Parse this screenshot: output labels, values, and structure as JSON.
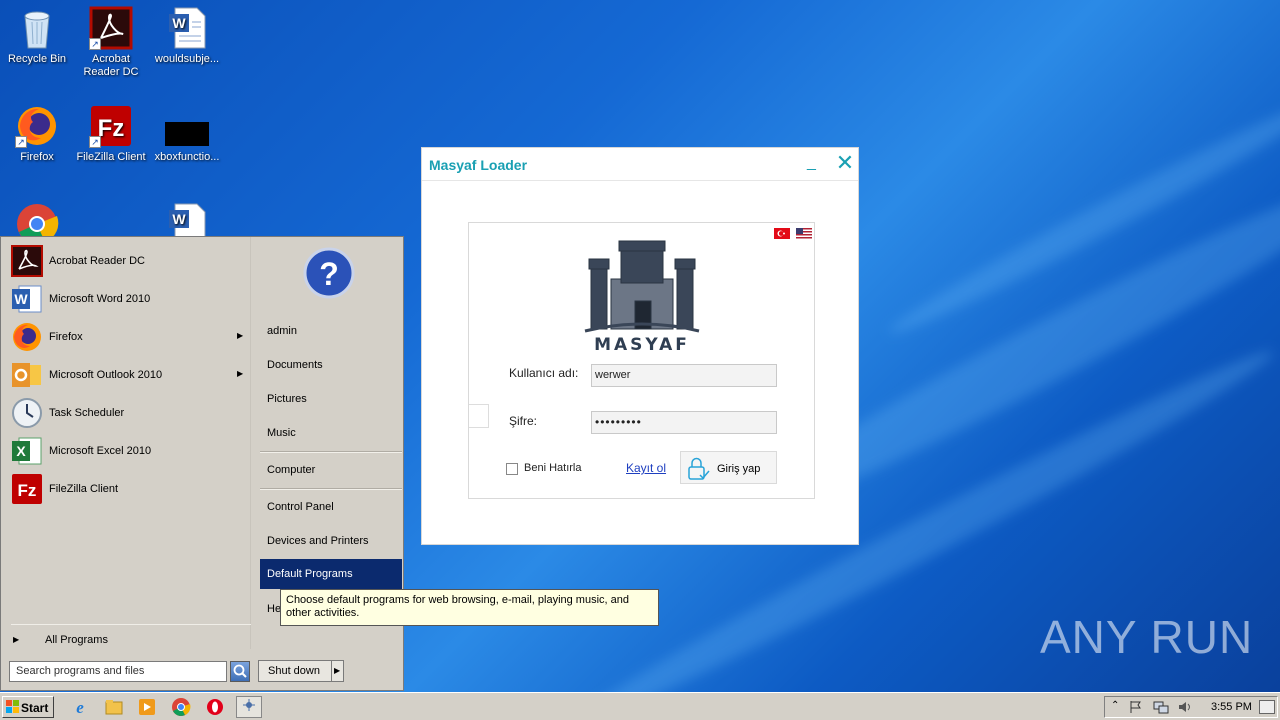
{
  "desktop": {
    "icons": [
      {
        "label": "Recycle Bin",
        "icon": "recycle-bin-icon"
      },
      {
        "label": "Acrobat Reader DC",
        "icon": "acrobat-icon"
      },
      {
        "label": "wouldsubje...",
        "icon": "word-doc-icon"
      },
      {
        "label": "Firefox",
        "icon": "firefox-icon"
      },
      {
        "label": "FileZilla Client",
        "icon": "filezilla-icon"
      },
      {
        "label": "xboxfunctio...",
        "icon": "black-file-icon"
      }
    ]
  },
  "loader": {
    "title": "Masyaf Loader",
    "minimize": "_",
    "close": "✕",
    "brand": "MASYAF",
    "username_label": "Kullanıcı adı:",
    "username_value": "werwer",
    "password_label": "Şifre:",
    "password_value": "•••••••••",
    "remember_label": "Beni Hatırla",
    "register_label": "Kayıt ol",
    "login_label": "Giriş yap",
    "flags": [
      "turkey-flag-icon",
      "us-flag-icon"
    ]
  },
  "start_menu": {
    "programs": [
      {
        "label": "Acrobat Reader DC",
        "icon": "acrobat-icon",
        "submenu": false
      },
      {
        "label": "Microsoft Word 2010",
        "icon": "word-icon",
        "submenu": false
      },
      {
        "label": "Firefox",
        "icon": "firefox-icon",
        "submenu": true
      },
      {
        "label": "Microsoft Outlook 2010",
        "icon": "outlook-icon",
        "submenu": true
      },
      {
        "label": "Task Scheduler",
        "icon": "clock-icon",
        "submenu": false
      },
      {
        "label": "Microsoft Excel 2010",
        "icon": "excel-icon",
        "submenu": false
      },
      {
        "label": "FileZilla Client",
        "icon": "filezilla-icon",
        "submenu": false
      }
    ],
    "all_programs": "All Programs",
    "search_placeholder": "Search programs and files",
    "right_items": [
      {
        "label": "admin"
      },
      {
        "label": "Documents"
      },
      {
        "label": "Pictures"
      },
      {
        "label": "Music"
      },
      {
        "label": "Computer"
      },
      {
        "label": "Control Panel"
      },
      {
        "label": "Devices and Printers"
      },
      {
        "label": "Default Programs"
      },
      {
        "label": "He"
      }
    ],
    "shutdown_label": "Shut down"
  },
  "tooltip": {
    "text": "Choose default programs for web browsing, e-mail, playing music, and other activities."
  },
  "taskbar": {
    "start_label": "Start",
    "clock": "3:55 PM",
    "pinned": [
      "ie-icon",
      "explorer-icon",
      "media-player-icon",
      "chrome-icon",
      "opera-icon",
      "network-app-icon"
    ]
  },
  "watermark": "ANY RUN"
}
